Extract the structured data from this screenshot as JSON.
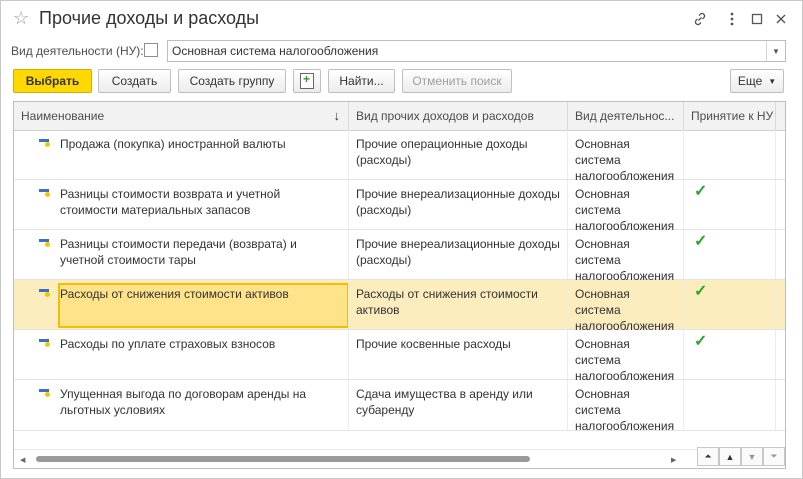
{
  "window": {
    "title": "Прочие доходы и расходы",
    "favorite_icon": "star-icon",
    "icons": [
      "link-icon",
      "more-icon",
      "maximize-icon",
      "close-icon"
    ]
  },
  "filter": {
    "label": "Вид деятельности (НУ):",
    "checked": false,
    "value": "Основная система налогообложения"
  },
  "toolbar": {
    "select_label": "Выбрать",
    "create_label": "Создать",
    "create_group_label": "Создать группу",
    "find_label": "Найти...",
    "cancel_search_label": "Отменить поиск",
    "more_label": "Еще",
    "colors": {
      "primary": "#ffd800"
    }
  },
  "table": {
    "columns": [
      "Наименование",
      "Вид прочих доходов и расходов",
      "Вид деятельнос...",
      "Принятие к НУ"
    ],
    "sort_indicator": "↓",
    "rows": [
      {
        "name": "Продажа (покупка) иностранной валюты",
        "kind": "Прочие операционные доходы (расходы)",
        "activity": "Основная система налогообложения",
        "accepted": false,
        "selected": false
      },
      {
        "name": "Разницы стоимости возврата и учетной стоимости материальных запасов",
        "kind": "Прочие внереализационные доходы (расходы)",
        "activity": "Основная система налогообложения",
        "accepted": true,
        "selected": false
      },
      {
        "name": "Разницы стоимости передачи (возврата) и учетной стоимости тары",
        "kind": "Прочие внереализационные доходы (расходы)",
        "activity": "Основная система налогообложения",
        "accepted": true,
        "selected": false
      },
      {
        "name": "Расходы от снижения стоимости активов",
        "kind": "Расходы от снижения стоимости активов",
        "activity": "Основная система налогообложения",
        "accepted": true,
        "selected": true
      },
      {
        "name": "Расходы по уплате страховых взносов",
        "kind": "Прочие косвенные расходы",
        "activity": "Основная система налогообложения",
        "accepted": true,
        "selected": false
      },
      {
        "name": "Упущенная выгода по договорам аренды на льготных условиях",
        "kind": "Сдача имущества в аренду или субаренду",
        "activity": "Основная система налогообложения",
        "accepted": false,
        "selected": false
      }
    ],
    "check_color": "#2aa52a",
    "selected_color": "#fbedbd"
  }
}
